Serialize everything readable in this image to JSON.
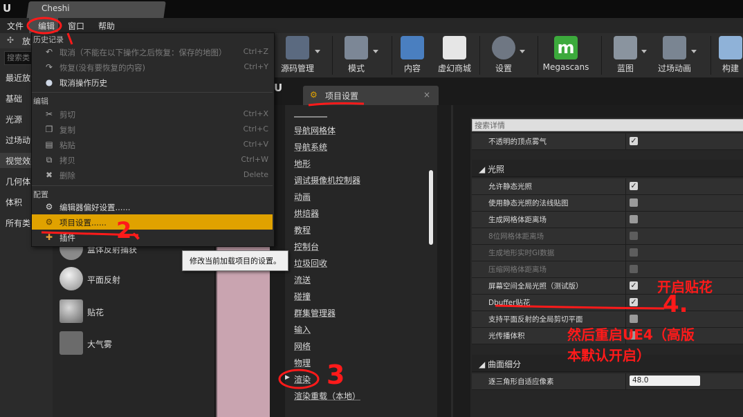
{
  "window": {
    "title": "Cheshi"
  },
  "menubar": {
    "items": [
      "文件",
      "编辑",
      "窗口",
      "帮助"
    ]
  },
  "place_panel": {
    "header": "放置",
    "search_placeholder": "搜索类",
    "categories": [
      "最近放置",
      "基础",
      "光源",
      "过场动画",
      "视觉效果",
      "几何体",
      "体积",
      "所有类"
    ],
    "assets": [
      "盒体反射捕获",
      "平面反射",
      "贴花",
      "大气雾"
    ]
  },
  "toolbar": {
    "buttons": [
      {
        "label": "源码管理",
        "icon": "source-control-icon"
      },
      {
        "label": "模式",
        "icon": "modes-icon"
      },
      {
        "label": "内容",
        "icon": "content-icon"
      },
      {
        "label": "虚幻商城",
        "icon": "marketplace-icon"
      },
      {
        "label": "设置",
        "icon": "settings-icon"
      },
      {
        "label": "Megascans",
        "icon": "megascans-icon"
      },
      {
        "label": "蓝图",
        "icon": "blueprint-icon"
      },
      {
        "label": "过场动画",
        "icon": "cinematics-icon"
      },
      {
        "label": "构建",
        "icon": "build-icon"
      }
    ]
  },
  "edit_menu": {
    "section_history": "历史记录",
    "undo": {
      "label": "取消（不能在以下操作之后恢复：保存的地图）",
      "shortcut": "Ctrl+Z"
    },
    "redo": {
      "label": "恢复(没有要恢复的内容)",
      "shortcut": "Ctrl+Y"
    },
    "undo_history": {
      "label": "取消操作历史"
    },
    "section_edit": "编辑",
    "cut": {
      "label": "剪切",
      "shortcut": "Ctrl+X"
    },
    "copy": {
      "label": "复制",
      "shortcut": "Ctrl+C"
    },
    "paste": {
      "label": "粘贴",
      "shortcut": "Ctrl+V"
    },
    "duplicate": {
      "label": "拷贝",
      "shortcut": "Ctrl+W"
    },
    "delete": {
      "label": "删除",
      "shortcut": "Delete"
    },
    "section_config": "配置",
    "editor_prefs": {
      "label": "编辑器偏好设置......"
    },
    "project_settings": {
      "label": "项目设置......"
    },
    "plugins": {
      "label": "插件"
    }
  },
  "tooltip": {
    "text": "修改当前加载项目的设置。"
  },
  "project_settings": {
    "tab_label": "项目设置",
    "close": "×",
    "nav_items": [
      "导航网格体",
      "导航系统",
      "地形",
      "调试摄像机控制器",
      "动画",
      "烘焙器",
      "教程",
      "控制台",
      "垃圾回收",
      "流送",
      "碰撞",
      "群集管理器",
      "输入",
      "网络",
      "物理",
      "渲染",
      "渲染重载（本地）"
    ],
    "nav_selected_marker": "▶",
    "search_placeholder": "搜索详情",
    "props_top": [
      {
        "label": "不透明的顶点雾气",
        "checked": true,
        "enabled": true
      }
    ],
    "lighting_section": "光照",
    "lighting_props": [
      {
        "label": "允许静态光照",
        "checked": true,
        "enabled": true
      },
      {
        "label": "使用静态光照的法线贴图",
        "checked": false,
        "enabled": true
      },
      {
        "label": "生成网格体距离场",
        "checked": false,
        "enabled": true
      },
      {
        "label": "8位网格体距离场",
        "checked": false,
        "enabled": false
      },
      {
        "label": "生成地形实时GI数据",
        "checked": false,
        "enabled": false
      },
      {
        "label": "压缩网格体距离场",
        "checked": false,
        "enabled": false
      },
      {
        "label": "屏幕空间全局光照（测试版）",
        "checked": true,
        "enabled": true
      },
      {
        "label": "Dbuffer贴花",
        "checked": true,
        "enabled": true
      },
      {
        "label": "支持平面反射的全局剪切平面",
        "checked": false,
        "enabled": true
      },
      {
        "label": "光传播体积",
        "checked": false,
        "enabled": true
      }
    ],
    "tessellation_section": "曲面细分",
    "tessellation_props": [
      {
        "label": "逐三角形自适应像素",
        "value": "48.0"
      }
    ]
  },
  "annotations": {
    "n1": "1",
    "n2": "2、",
    "n3": "3",
    "n4": "4.",
    "enable_decal": "开启贴花",
    "restart_note_line1": "然后重启UE4（高版",
    "restart_note_line2": "本默认开启）",
    "color": "#ff1a1a"
  }
}
